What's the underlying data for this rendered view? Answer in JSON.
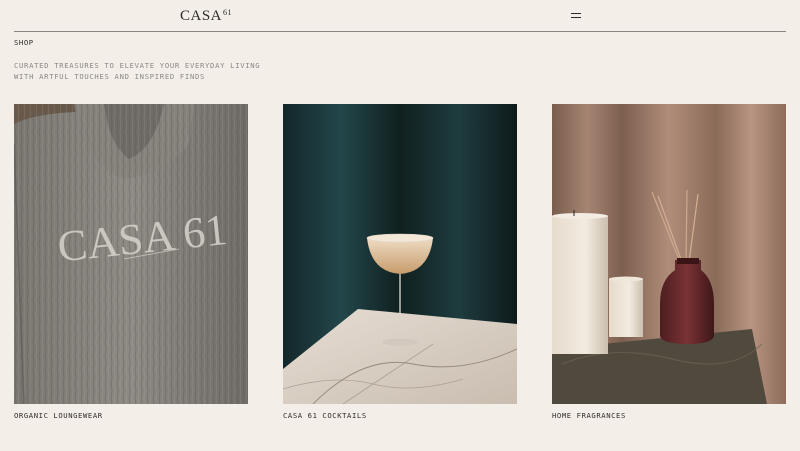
{
  "header": {
    "logo_text": "CASA",
    "logo_sup": "61",
    "menu_icon": "hamburger-icon"
  },
  "breadcrumb": {
    "label": "SHOP"
  },
  "intro": {
    "line1": "CURATED TREASURES TO ELEVATE YOUR EVERYDAY LIVING",
    "line2": "WITH ARTFUL TOUCHES AND INSPIRED FINDS"
  },
  "products": [
    {
      "caption": "ORGANIC LOUNGEWEAR",
      "image": "loungewear-robe-photo",
      "print_text": "CASA 61"
    },
    {
      "caption": "CASA 61 COCKTAILS",
      "image": "cocktail-coupe-photo"
    },
    {
      "caption": "HOME FRAGRANCES",
      "image": "candles-diffuser-photo"
    }
  ]
}
